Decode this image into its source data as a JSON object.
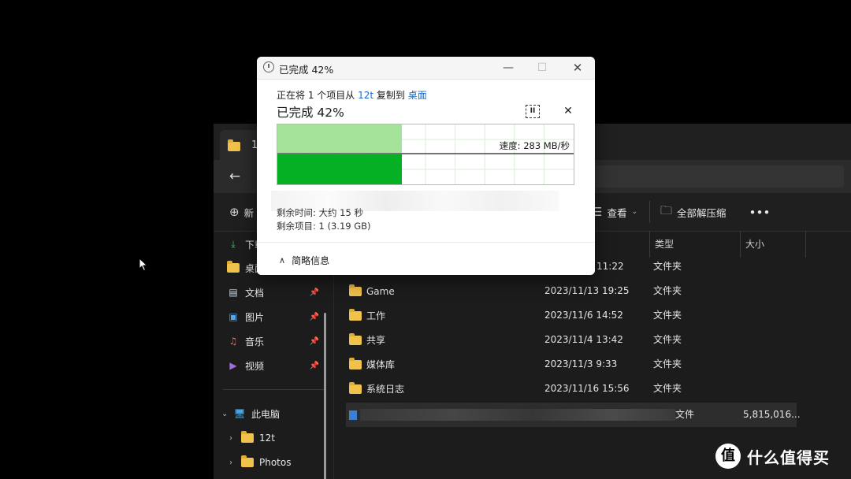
{
  "explorer": {
    "tab_label": "12t",
    "toolbar": {
      "new_label": "新",
      "view_label": "查看",
      "extract_all_label": "全部解压缩",
      "more_label": "•••"
    },
    "sidebar": {
      "items": [
        {
          "label": "下载",
          "icon": "download-icon"
        },
        {
          "label": "桌面",
          "icon": "folder-icon"
        },
        {
          "label": "文档",
          "icon": "document-icon"
        },
        {
          "label": "图片",
          "icon": "pictures-icon"
        },
        {
          "label": "音乐",
          "icon": "music-icon"
        },
        {
          "label": "视频",
          "icon": "video-icon"
        }
      ],
      "this_pc_label": "此电脑",
      "drives": [
        {
          "label": "12t"
        },
        {
          "label": "Photos"
        }
      ]
    },
    "columns": {
      "type": "类型",
      "size": "大小"
    },
    "rows": [
      {
        "name": "",
        "date": "11:22",
        "type": "文件夹",
        "size": ""
      },
      {
        "name": "Game",
        "date": "2023/11/13 19:25",
        "type": "文件夹",
        "size": ""
      },
      {
        "name": "工作",
        "date": "2023/11/6 14:52",
        "type": "文件夹",
        "size": ""
      },
      {
        "name": "共享",
        "date": "2023/11/4 13:42",
        "type": "文件夹",
        "size": ""
      },
      {
        "name": "媒体库",
        "date": "2023/11/3 9:33",
        "type": "文件夹",
        "size": ""
      },
      {
        "name": "系统日志",
        "date": "2023/11/16 15:56",
        "type": "文件夹",
        "size": ""
      },
      {
        "name": "",
        "date": "",
        "type": "文件",
        "size": "5,815,016..."
      }
    ]
  },
  "dialog": {
    "title": "已完成 42%",
    "copy_desc": {
      "prefix": "正在将 1 个项目从 ",
      "source": "12t",
      "middle": " 复制到 ",
      "dest": "桌面"
    },
    "progress_title": "已完成 42%",
    "progress_fraction": 0.42,
    "speed_label": "速度: 283 MB/秒",
    "time_left": "剩余时间: 大约 15 秒",
    "items_left": "剩余项目: 1 (3.19 GB)",
    "details_toggle": "简略信息",
    "colors": {
      "progress_green": "#06b025",
      "progress_light": "#a6e39a"
    }
  },
  "watermark": {
    "logo": "值",
    "text": "什么值得买"
  }
}
